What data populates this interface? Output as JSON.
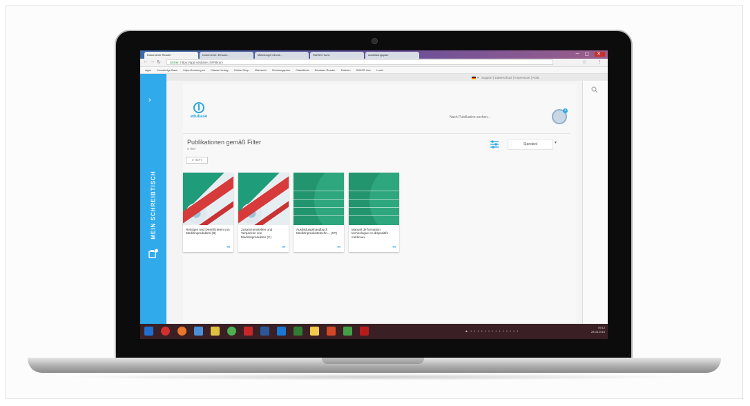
{
  "browser": {
    "tabs": [
      {
        "label": "Dokumente Reader"
      },
      {
        "label": "Dokumente: Einsatz..."
      },
      {
        "label": "Mitteilungen Bund..."
      },
      {
        "label": "SWISS Home"
      },
      {
        "label": "Ausbildungsplan"
      }
    ],
    "url": "https://app.edubase.ch/#library",
    "url_secure_label": "Sicher",
    "bookmarks": [
      "Apps",
      "Knowledge Base",
      "https://learning.ch",
      "Classic Verlag",
      "Online Shop",
      "Übersicht",
      "Schulungsplan",
      "Classifieds",
      "Edubase Reader",
      "Dateien",
      "SWISS Live",
      "Lucid"
    ]
  },
  "sidebar": {
    "label": "MEIN SCHREIBTISCH",
    "chevron": "›"
  },
  "topbar": {
    "language_arrow": "▾",
    "links": "Support | Datenschutz | Impressum | AGB"
  },
  "app": {
    "logo_text": "edubase",
    "search_placeholder": "Nach Publikation suchen...",
    "avatar_badge": "+",
    "page_title": "Publikationen gemäß Filter",
    "subtitle": "5 Titel",
    "chip_label": "✕ HKFT",
    "sort_label": "Standard",
    "sort_arrow": "▾"
  },
  "books": [
    {
      "title": "Reinigen und Desinfizieren von Medizinprodukten (B)",
      "more": "•••"
    },
    {
      "title": "Zusammenstellen und Verpacken von Medizinprodukten (C)",
      "more": "•••"
    },
    {
      "title": "Ausbildungshandbuch Medizinproduktetechn... (ST)",
      "more": "•••"
    },
    {
      "title": "Manuel de formation technologue en dispositifs médicaux",
      "more": "•••"
    }
  ],
  "taskbar": {
    "time": "09:12",
    "date": "28.08.2018"
  },
  "colors": {
    "accent": "#30aaeb",
    "cover_green": "#22946e",
    "cover_red": "#d63a3a",
    "taskbar": "#3a2024"
  }
}
